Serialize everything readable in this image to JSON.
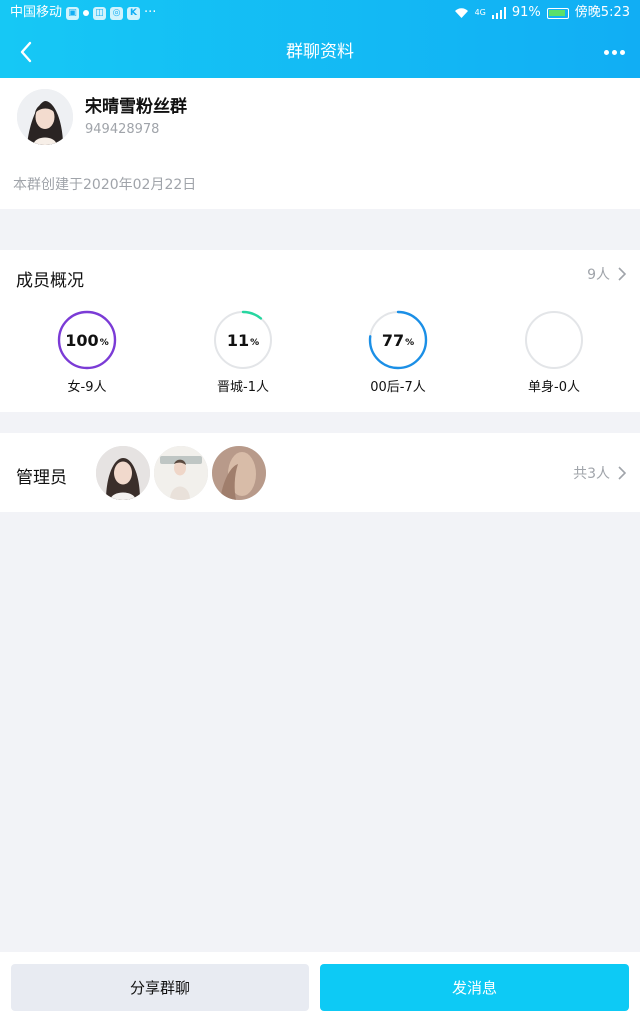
{
  "status_bar": {
    "carrier": "中国移动",
    "battery_percent": "91%",
    "time": "傍晚5:23",
    "network": "4G"
  },
  "nav": {
    "title": "群聊资料"
  },
  "group": {
    "name": "宋晴雪粉丝群",
    "id": "949428978",
    "created": "本群创建于2020年02月22日"
  },
  "members": {
    "title": "成员概况",
    "count": "9人",
    "stats": [
      {
        "num": "100",
        "unit": "%",
        "label": "女-9人",
        "fraction": 1.0,
        "color": "#7b3bd6"
      },
      {
        "num": "11",
        "unit": "%",
        "label": "晋城-1人",
        "fraction": 0.11,
        "color": "#27d6a0"
      },
      {
        "num": "77",
        "unit": "%",
        "label": "00后-7人",
        "fraction": 0.77,
        "color": "#1b8fe6"
      },
      {
        "num": "",
        "unit": "",
        "label": "单身-0人",
        "fraction": 0.0,
        "color": "#cfd3d8"
      }
    ]
  },
  "admins": {
    "title": "管理员",
    "count": "共3人"
  },
  "buttons": {
    "share": "分享群聊",
    "send": "发消息"
  },
  "colors": {
    "header": "#11aef4",
    "send_button": "#0dcaf5"
  }
}
